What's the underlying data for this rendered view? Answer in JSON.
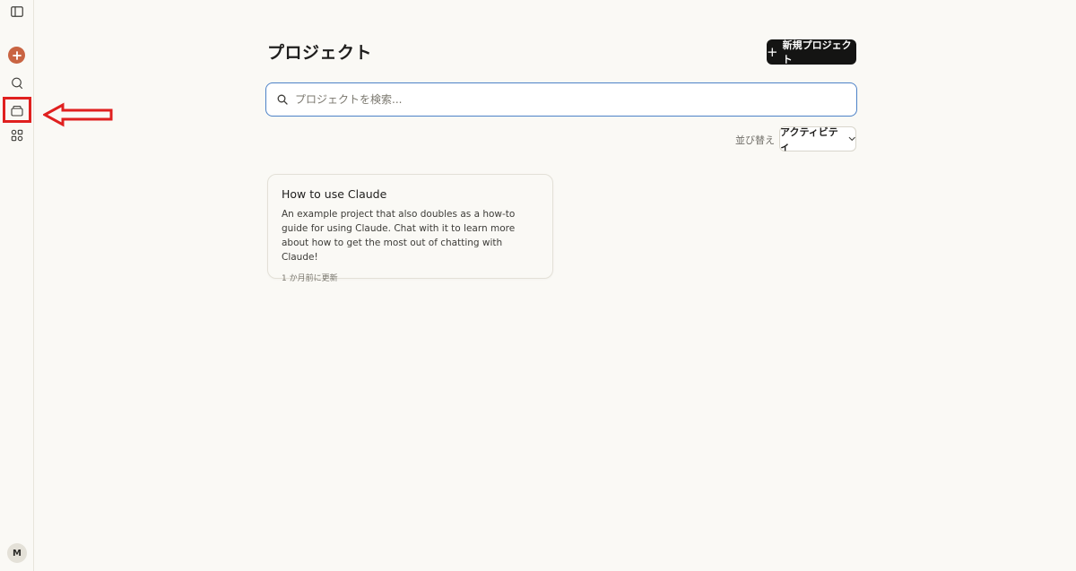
{
  "sidebar": {
    "avatar_initial": "M"
  },
  "main": {
    "title": "プロジェクト",
    "new_project_label": "新規プロジェクト",
    "search": {
      "placeholder": "プロジェクトを検索..."
    },
    "sort": {
      "label": "並び替え",
      "value": "アクティビティ"
    },
    "projects": [
      {
        "title": "How to use Claude",
        "description": "An example project that also doubles as a how-to guide for using Claude. Chat with it to learn more about how to get the most out of chatting with Claude!",
        "updated": "1 か月前に更新"
      }
    ]
  },
  "colors": {
    "accent": "#c96442",
    "primary_button": "#141413",
    "focus_border": "#4d82c7",
    "annotation": "#e0201f",
    "background": "#faf9f5"
  }
}
